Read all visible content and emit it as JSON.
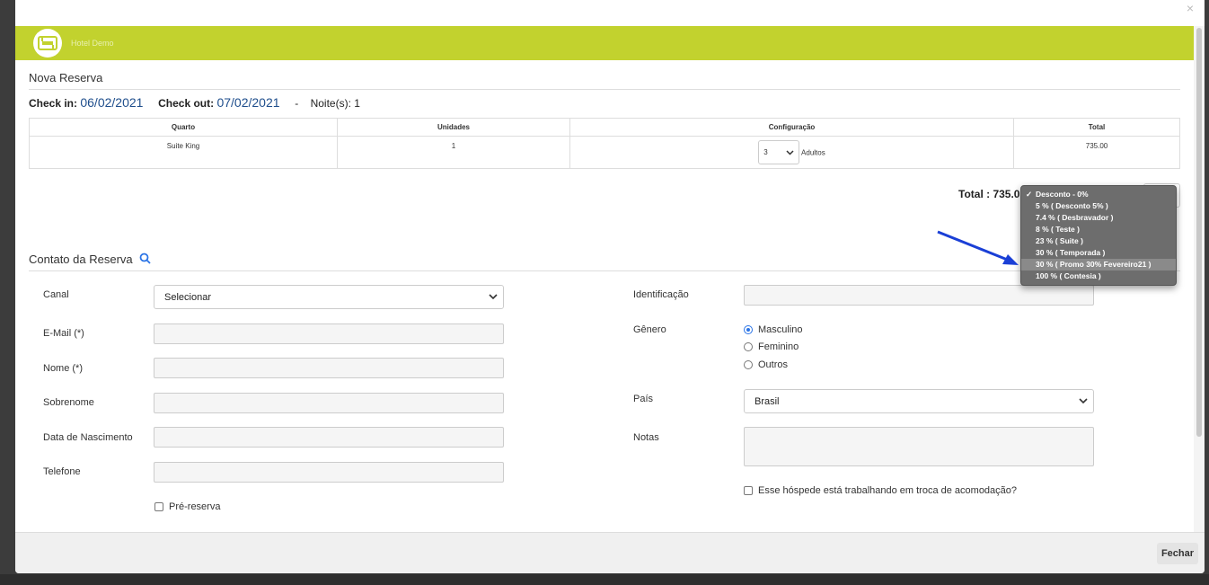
{
  "modal": {
    "close_symbol": "×",
    "hotel_name": "Hotel Demo",
    "logo_icon": "hotel-bed-icon",
    "accent_color": "#c2d22e"
  },
  "reserva": {
    "title": "Nova Reserva",
    "checkin_label": "Check in:",
    "checkin_value": "06/02/2021",
    "checkout_label": "Check out:",
    "checkout_value": "07/02/2021",
    "separator": "-",
    "noites_label": "Noite(s):",
    "noites_value": "1"
  },
  "rooms_table": {
    "headers": [
      "Quarto",
      "Unidades",
      "Configuração",
      "Total"
    ],
    "rows": [
      {
        "quarto": "Suite King",
        "unidades": "1",
        "config_value": "3",
        "config_unit": "Adultos",
        "total": "735.00"
      }
    ]
  },
  "total": {
    "label": "Total : 735.0"
  },
  "discount_dropdown": {
    "options": [
      "Desconto - 0%",
      "5 % ( Desconto 5% )",
      "7.4 % ( Desbravador )",
      "8 % ( Teste )",
      "23 % ( Suite )",
      "30 % ( Temporada )",
      "30 % ( Promo 30% Fevereiro21 )",
      "100 % ( Contesia )"
    ],
    "selected_index": 0,
    "highlighted_index": 6,
    "check_mark": "✓"
  },
  "contato": {
    "title": "Contato da Reserva",
    "search_icon": "search-icon",
    "canal_label": "Canal",
    "canal_value": "Selecionar",
    "email_label": "E-Mail (*)",
    "nome_label": "Nome (*)",
    "sobrenome_label": "Sobrenome",
    "nascimento_label": "Data de Nascimento",
    "telefone_label": "Telefone",
    "prereserva_label": "Pré-reserva",
    "identificacao_label": "Identificação",
    "genero_label": "Gênero",
    "genero_options": [
      "Masculino",
      "Feminino",
      "Outros"
    ],
    "genero_selected": "Masculino",
    "pais_label": "País",
    "pais_value": "Brasil",
    "notas_label": "Notas",
    "troca_label": "Esse hóspede está trabalhando em troca de acomodação?"
  },
  "footer": {
    "close_button": "Fechar"
  }
}
